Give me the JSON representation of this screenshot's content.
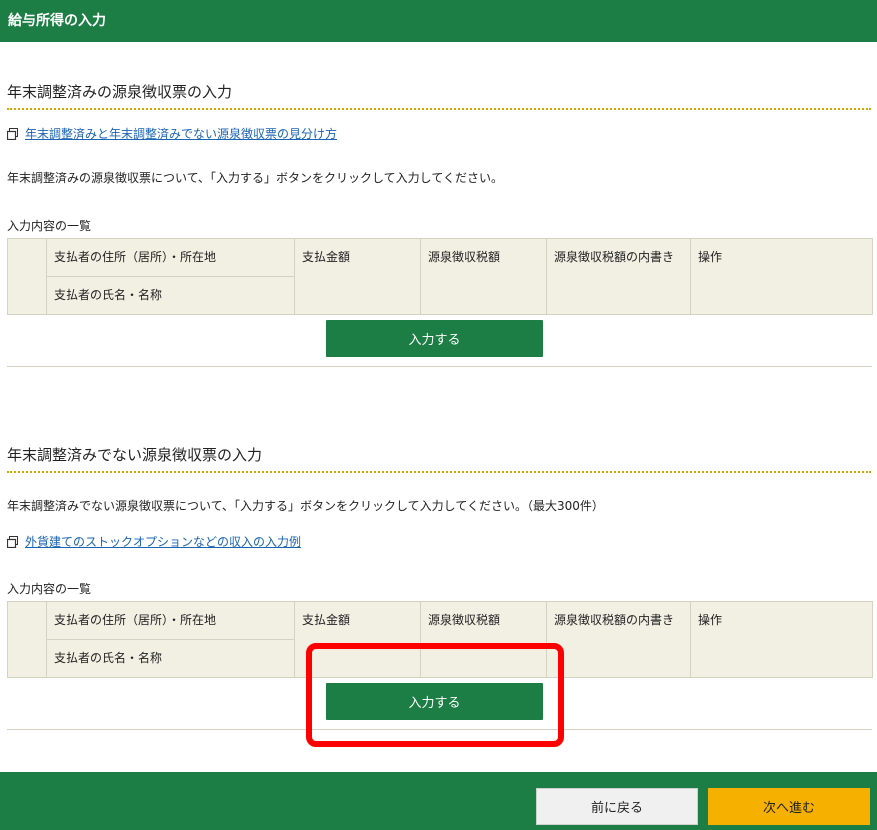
{
  "header": {
    "title": "給与所得の入力"
  },
  "section1": {
    "title": "年末調整済みの源泉徴収票の入力",
    "link": "年末調整済みと年末調整済みでない源泉徴収票の見分け方",
    "description": "年末調整済みの源泉徴収票について、「入力する」ボタンをクリックして入力してください。",
    "list_label": "入力内容の一覧",
    "table": {
      "col_address": "支払者の住所（居所）・所在地",
      "col_name": "支払者の氏名・名称",
      "col_amount": "支払金額",
      "col_tax": "源泉徴収税額",
      "col_tax_detail": "源泉徴収税額の内書き",
      "col_action": "操作"
    },
    "button_label": "入力する"
  },
  "section2": {
    "title": "年末調整済みでない源泉徴収票の入力",
    "description": "年末調整済みでない源泉徴収票について、「入力する」ボタンをクリックして入力してください。（最大300件）",
    "link": "外貨建てのストックオプションなどの収入の入力例",
    "list_label": "入力内容の一覧",
    "table": {
      "col_address": "支払者の住所（居所）・所在地",
      "col_name": "支払者の氏名・名称",
      "col_amount": "支払金額",
      "col_tax": "源泉徴収税額",
      "col_tax_detail": "源泉徴収税額の内書き",
      "col_action": "操作"
    },
    "button_label": "入力する"
  },
  "footer": {
    "prev_label": "前に戻る",
    "next_label": "次へ進む"
  },
  "colors": {
    "brand_green": "#1c7e44",
    "next_yellow": "#f6b000",
    "highlight_red": "#ff0000",
    "link_blue": "#1a64b4"
  },
  "icons": {
    "link_icon": "external-document-icon"
  }
}
